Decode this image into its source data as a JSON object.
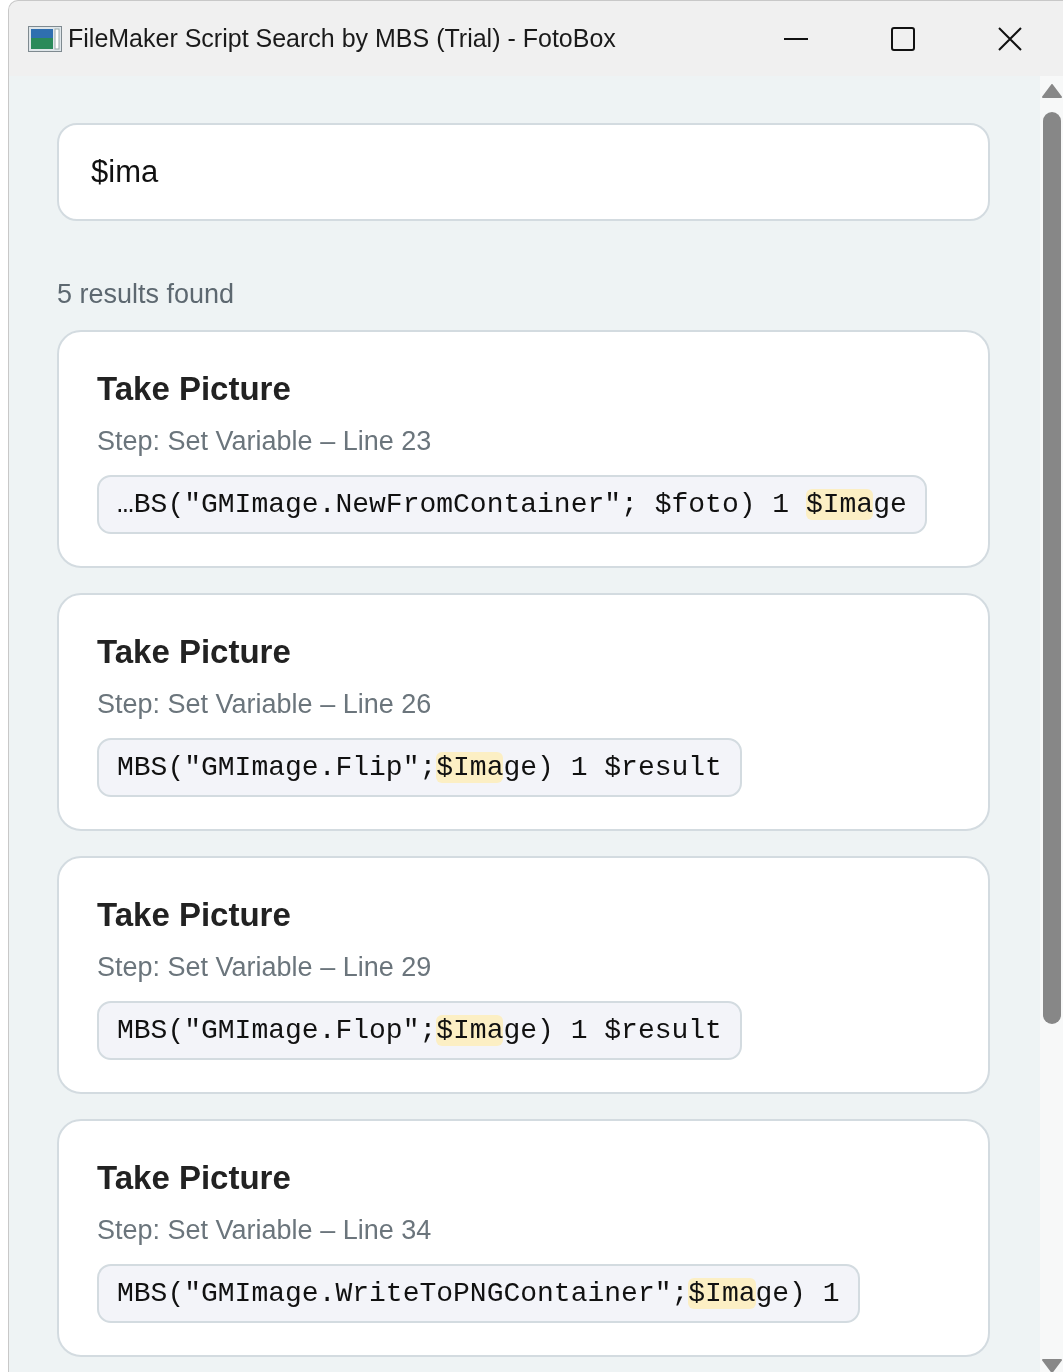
{
  "window": {
    "title": "FileMaker Script Search by MBS (Trial) - FotoBox"
  },
  "search": {
    "value": "$ima"
  },
  "result_count": "5 results found",
  "results": [
    {
      "title": "Take Picture",
      "step": "Step: Set Variable – Line 23",
      "code": {
        "before": "…BS(\"GMImage.NewFromContainer\"; $foto) 1 ",
        "match": "$Ima",
        "after": "ge"
      }
    },
    {
      "title": "Take Picture",
      "step": "Step: Set Variable – Line 26",
      "code": {
        "before": "MBS(\"GMImage.Flip\";",
        "match": "$Ima",
        "after": "ge) 1 $result"
      }
    },
    {
      "title": "Take Picture",
      "step": "Step: Set Variable – Line 29",
      "code": {
        "before": "MBS(\"GMImage.Flop\";",
        "match": "$Ima",
        "after": "ge) 1 $result"
      }
    },
    {
      "title": "Take Picture",
      "step": "Step: Set Variable – Line 34",
      "code": {
        "before": "MBS(\"GMImage.WriteToPNGContainer\";",
        "match": "$Ima",
        "after": "ge) 1"
      }
    }
  ]
}
